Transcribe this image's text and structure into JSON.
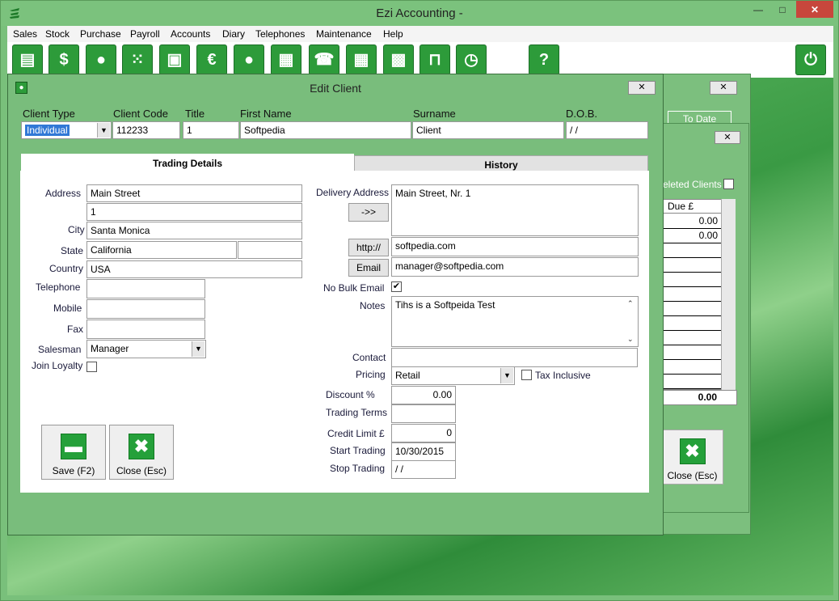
{
  "app": {
    "title": "Ezi Accounting -",
    "logo_icon": "ezi-logo-icon",
    "min_label": "—",
    "max_label": "□",
    "close_label": "✕"
  },
  "menu": [
    "Sales",
    "Stock",
    "Purchase",
    "Payroll",
    "Accounts",
    "Diary",
    "Telephones",
    "Maintenance",
    "Help"
  ],
  "toolbar": {
    "icons": [
      "document-icon",
      "dollar-icon",
      "client-icon",
      "dots-icon",
      "box-icon",
      "euro-icon",
      "user-icon",
      "register-icon",
      "phone-icon",
      "calendar-grid-icon",
      "calculator-icon",
      "unlock-icon",
      "clock-icon",
      "help-icon",
      "power-icon"
    ],
    "glyphs": [
      "▤",
      "$",
      "●",
      "⁙",
      "▣",
      "€",
      "●",
      "▦",
      "☎",
      "▦",
      "▩",
      "⊓",
      "◷",
      "?",
      "⏻"
    ]
  },
  "background": {
    "to_date": "To Date",
    "deleted_clients": "eleted Clients",
    "due_header": "Due £",
    "rows": [
      "0.00",
      "0.00",
      "",
      "",
      "",
      "",
      "",
      "",
      "",
      "",
      "",
      ""
    ],
    "total": "0.00",
    "close_label": "Close (Esc)"
  },
  "dialog": {
    "title": "Edit Client",
    "close": "✕",
    "header": {
      "client_type_label": "Client Type",
      "client_type_value": "Individual",
      "client_code_label": "Client Code",
      "client_code_value": "112233",
      "title_label": "Title",
      "title_value": "1",
      "first_name_label": "First Name",
      "first_name_value": "Softpedia",
      "surname_label": "Surname",
      "surname_value": "Client",
      "dob_label": "D.O.B.",
      "dob_value": " / /"
    },
    "tabs": {
      "trading": "Trading Details",
      "history": "History"
    },
    "left": {
      "address_label": "Address",
      "address_1": "Main Street",
      "address_2": "1",
      "city_label": "City",
      "city_value": "Santa Monica",
      "state_label": "State",
      "state_value": "California",
      "state_extra": "",
      "country_label": "Country",
      "country_value": "USA",
      "telephone_label": "Telephone",
      "telephone_value": "",
      "mobile_label": "Mobile",
      "mobile_value": "",
      "fax_label": "Fax",
      "fax_value": "",
      "salesman_label": "Salesman",
      "salesman_value": "Manager",
      "join_loyalty_label": "Join Loyalty"
    },
    "right": {
      "delivery_label": "Delivery Address",
      "delivery_value": "Main Street, Nr. 1",
      "copy_button": "->>",
      "http_button": "http://",
      "web_value": "softpedia.com",
      "email_button": "Email",
      "email_value": "manager@softpedia.com",
      "no_bulk_email_label": "No Bulk Email",
      "no_bulk_email_check": "✔",
      "notes_label": "Notes",
      "notes_value": "Tihs is a Softpeida Test",
      "contact_label": "Contact",
      "contact_value": "",
      "pricing_label": "Pricing",
      "pricing_value": "Retail",
      "tax_inclusive_label": "Tax Inclusive",
      "discount_label": "Discount %",
      "discount_value": "0.00",
      "trading_terms_label": "Trading Terms",
      "trading_terms_value": "",
      "credit_limit_label": "Credit Limit £",
      "credit_limit_value": "0",
      "start_trading_label": "Start Trading",
      "start_trading_value": "10/30/2015",
      "stop_trading_label": "Stop Trading",
      "stop_trading_value": " / /"
    },
    "buttons": {
      "save_label": "Save (F2)",
      "close_label": "Close (Esc)",
      "save_glyph": "▬",
      "close_glyph": "✖"
    }
  },
  "colors": {
    "accent_green": "#2d9b3a",
    "window_green": "#79bd7c"
  }
}
